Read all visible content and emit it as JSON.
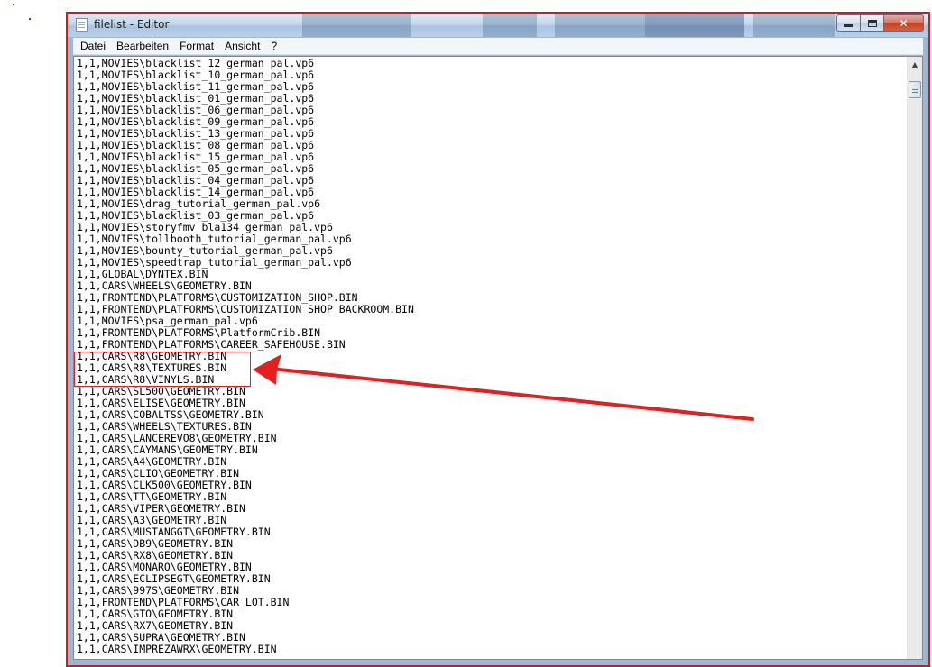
{
  "window": {
    "title": "filelist - Editor",
    "close_glyph": "✕"
  },
  "menu": [
    "Datei",
    "Bearbeiten",
    "Format",
    "Ansicht",
    "?"
  ],
  "lines": [
    "1,1,MOVIES\\blacklist_12_german_pal.vp6",
    "1,1,MOVIES\\blacklist_10_german_pal.vp6",
    "1,1,MOVIES\\blacklist_11_german_pal.vp6",
    "1,1,MOVIES\\blacklist_01_german_pal.vp6",
    "1,1,MOVIES\\blacklist_06_german_pal.vp6",
    "1,1,MOVIES\\blacklist_09_german_pal.vp6",
    "1,1,MOVIES\\blacklist_13_german_pal.vp6",
    "1,1,MOVIES\\blacklist_08_german_pal.vp6",
    "1,1,MOVIES\\blacklist_15_german_pal.vp6",
    "1,1,MOVIES\\blacklist_05_german_pal.vp6",
    "1,1,MOVIES\\blacklist_04_german_pal.vp6",
    "1,1,MOVIES\\blacklist_14_german_pal.vp6",
    "1,1,MOVIES\\drag_tutorial_german_pal.vp6",
    "1,1,MOVIES\\blacklist_03_german_pal.vp6",
    "1,1,MOVIES\\storyfmv_bla134_german_pal.vp6",
    "1,1,MOVIES\\tollbooth_tutorial_german_pal.vp6",
    "1,1,MOVIES\\bounty_tutorial_german_pal.vp6",
    "1,1,MOVIES\\speedtrap_tutorial_german_pal.vp6",
    "1,1,GLOBAL\\DYNTEX.BIN",
    "1,1,CARS\\WHEELS\\GEOMETRY.BIN",
    "1,1,FRONTEND\\PLATFORMS\\CUSTOMIZATION_SHOP.BIN",
    "1,1,FRONTEND\\PLATFORMS\\CUSTOMIZATION_SHOP_BACKROOM.BIN",
    "1,1,MOVIES\\psa_german_pal.vp6",
    "1,1,FRONTEND\\PLATFORMS\\PlatformCrib.BIN",
    "1,1,FRONTEND\\PLATFORMS\\CAREER_SAFEHOUSE.BIN",
    "1,1,CARS\\R8\\GEOMETRY.BIN",
    "1,1,CARS\\R8\\TEXTURES.BIN",
    "1,1,CARS\\R8\\VINYLS.BIN",
    "1,1,CARS\\SL500\\GEOMETRY.BIN",
    "1,1,CARS\\ELISE\\GEOMETRY.BIN",
    "1,1,CARS\\COBALTSS\\GEOMETRY.BIN",
    "1,1,CARS\\WHEELS\\TEXTURES.BIN",
    "1,1,CARS\\LANCEREVO8\\GEOMETRY.BIN",
    "1,1,CARS\\CAYMANS\\GEOMETRY.BIN",
    "1,1,CARS\\A4\\GEOMETRY.BIN",
    "1,1,CARS\\CLIO\\GEOMETRY.BIN",
    "1,1,CARS\\CLK500\\GEOMETRY.BIN",
    "1,1,CARS\\TT\\GEOMETRY.BIN",
    "1,1,CARS\\VIPER\\GEOMETRY.BIN",
    "1,1,CARS\\A3\\GEOMETRY.BIN",
    "1,1,CARS\\MUSTANGGT\\GEOMETRY.BIN",
    "1,1,CARS\\DB9\\GEOMETRY.BIN",
    "1,1,CARS\\RX8\\GEOMETRY.BIN",
    "1,1,CARS\\MONARO\\GEOMETRY.BIN",
    "1,1,CARS\\ECLIPSEGT\\GEOMETRY.BIN",
    "1,1,CARS\\997S\\GEOMETRY.BIN",
    "1,1,FRONTEND\\PLATFORMS\\CAR_LOT.BIN",
    "1,1,CARS\\GTO\\GEOMETRY.BIN",
    "1,1,CARS\\RX7\\GEOMETRY.BIN",
    "1,1,CARS\\SUPRA\\GEOMETRY.BIN",
    "1,1,CARS\\IMPREZAWRX\\GEOMETRY.BIN"
  ],
  "annotation": {
    "highlight_color": "#e31f1f",
    "arrow_color": "#e31f1f"
  },
  "scrollbar": {
    "up_arrow": "▲",
    "position_fraction": 0.05
  }
}
